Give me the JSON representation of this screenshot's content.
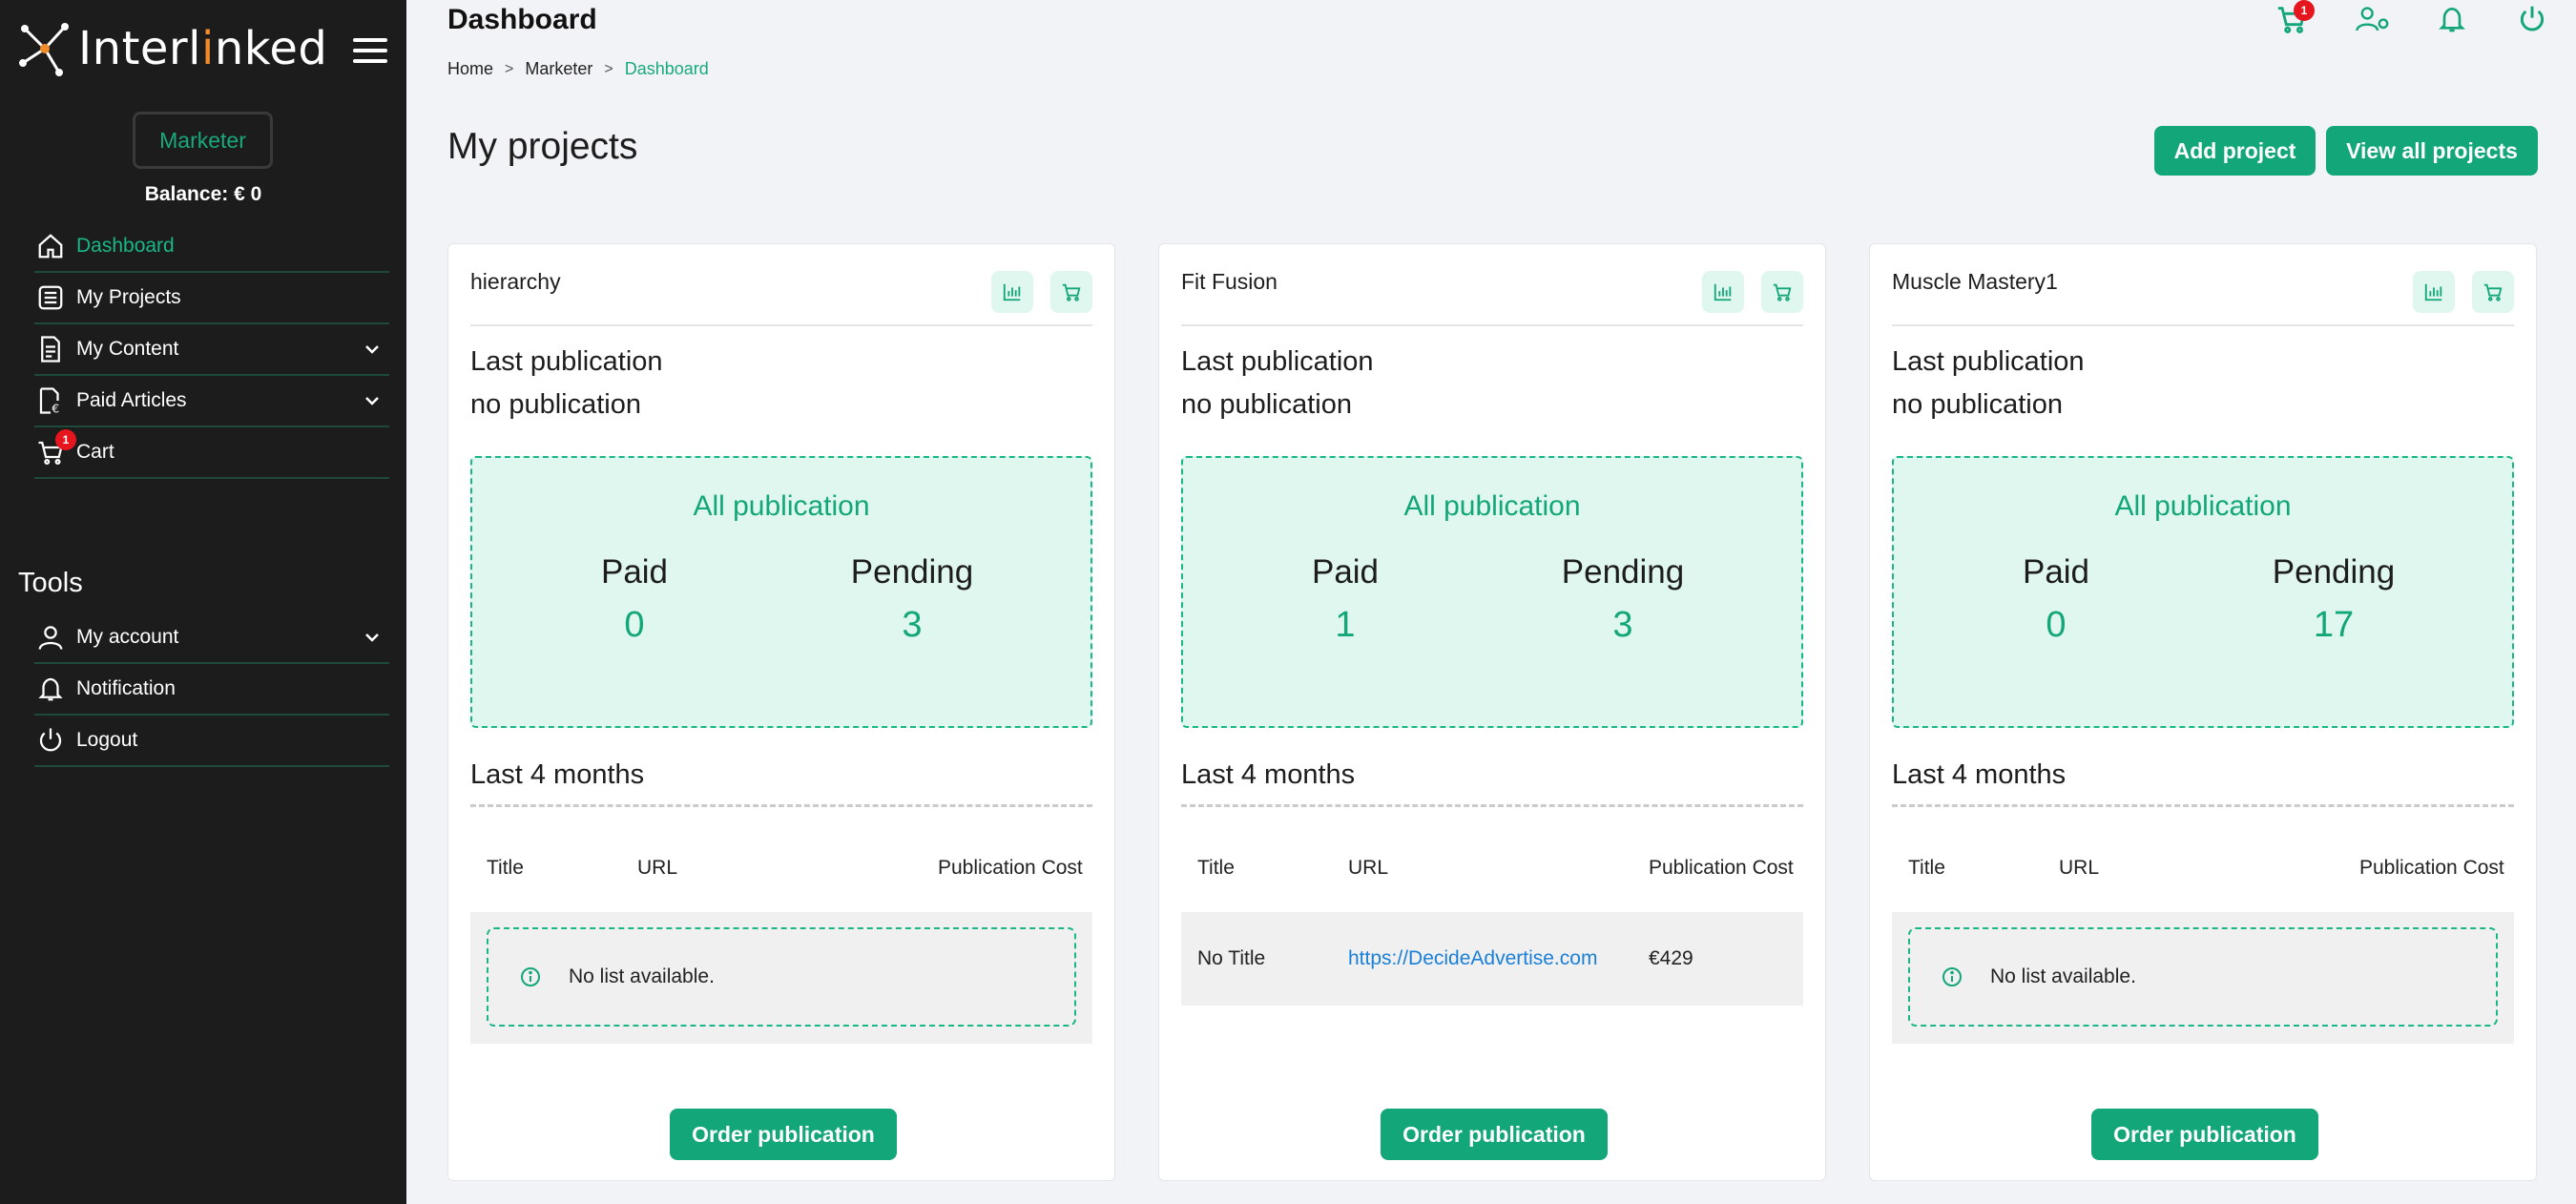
{
  "app": {
    "logo_text_a": "Interl",
    "logo_text_b": "i",
    "logo_text_c": "nked",
    "role": "Marketer",
    "balance": "Balance: € 0"
  },
  "sidebar": {
    "items": [
      {
        "label": "Dashboard",
        "icon": "home-icon",
        "active": true
      },
      {
        "label": "My Projects",
        "icon": "list-icon"
      },
      {
        "label": "My Content",
        "icon": "document-icon",
        "expandable": true
      },
      {
        "label": "Paid Articles",
        "icon": "paid-document-icon",
        "expandable": true
      },
      {
        "label": "Cart",
        "icon": "cart-icon",
        "badge": "1"
      }
    ],
    "tools_title": "Tools",
    "tools": [
      {
        "label": "My account",
        "icon": "user-icon",
        "expandable": true
      },
      {
        "label": "Notification",
        "icon": "bell-icon"
      },
      {
        "label": "Logout",
        "icon": "power-icon"
      }
    ]
  },
  "header": {
    "title": "Dashboard",
    "breadcrumb": [
      "Home",
      "Marketer",
      "Dashboard"
    ],
    "cart_badge": "1"
  },
  "main": {
    "section_title": "My projects",
    "add_project_label": "Add project",
    "view_all_label": "View all projects"
  },
  "projects": [
    {
      "name": "hierarchy",
      "last_publication_label": "Last publication",
      "last_publication_value": "no publication",
      "all_publication_label": "All publication",
      "paid_label": "Paid",
      "paid_value": "0",
      "pending_label": "Pending",
      "pending_value": "3",
      "last_months_label": "Last 4 months",
      "columns": [
        "Title",
        "URL",
        "Publication Cost"
      ],
      "rows": [],
      "empty_text": "No list available.",
      "order_label": "Order publication"
    },
    {
      "name": "Fit Fusion",
      "last_publication_label": "Last publication",
      "last_publication_value": "no publication",
      "all_publication_label": "All publication",
      "paid_label": "Paid",
      "paid_value": "1",
      "pending_label": "Pending",
      "pending_value": "3",
      "last_months_label": "Last 4 months",
      "columns": [
        "Title",
        "URL",
        "Publication Cost"
      ],
      "rows": [
        {
          "title": "No Title",
          "url": "https://DecideAdvertise.com",
          "cost": "€429"
        }
      ],
      "empty_text": "",
      "order_label": "Order publication"
    },
    {
      "name": "Muscle Mastery1",
      "last_publication_label": "Last publication",
      "last_publication_value": "no publication",
      "all_publication_label": "All publication",
      "paid_label": "Paid",
      "paid_value": "0",
      "pending_label": "Pending",
      "pending_value": "17",
      "last_months_label": "Last 4 months",
      "columns": [
        "Title",
        "URL",
        "Publication Cost"
      ],
      "rows": [],
      "empty_text": "No list available.",
      "order_label": "Order publication"
    }
  ],
  "colors": {
    "accent": "#13a679",
    "sidebar_bg": "#1c1c1c",
    "stats_bg": "#dff7ee",
    "badge": "#e5161e",
    "link": "#1a7fd8"
  }
}
